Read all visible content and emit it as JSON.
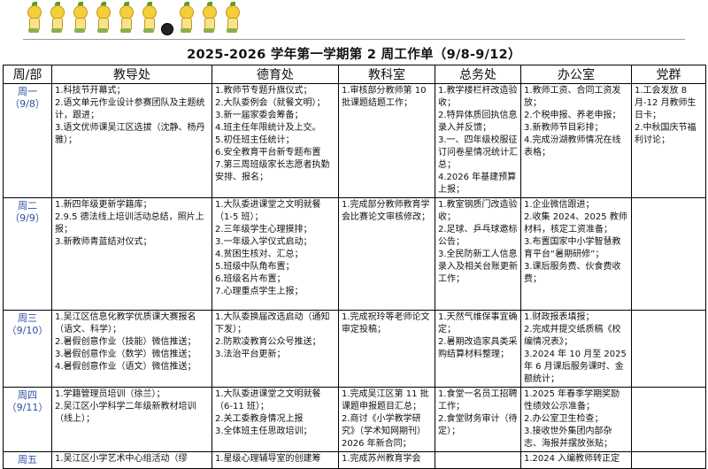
{
  "title": "2025-2026 学年第一学期第 2 周工作单（9/8-9/12）",
  "headers": [
    "周/部",
    "教导处",
    "德育处",
    "教科室",
    "总务处",
    "办公室",
    "党群"
  ],
  "rows": [
    {
      "day": "周一",
      "date": "（9/8）",
      "cells": [
        [
          "1.科技节开幕式；",
          "2.语文单元作业设计参赛团队及主题统计，跟进；",
          "3.语文优师课吴江区选拔（沈静、杨丹雅）；"
        ],
        [
          "1.教师节专题升旗仪式；",
          "2.大队委例会（就餐文明）；",
          "3.新一届家委会筹备；",
          "4.班主任年限统计及上交。",
          "5.初任班主任统计；",
          "6.安全教育平台新专题布置",
          "7.第三周班级家长志愿者执勤安排、报名；"
        ],
        [
          "1.审核部分教师第 10 批课题结题工作；"
        ],
        [
          "1.教学楼栏杆改造验收；",
          "2.特异体质回执信息录入并反馈；",
          "3.一、四年级校服征订问卷星情况统计汇总；",
          "4.2026 年基建预算上报；"
        ],
        [
          "1.教师工资、合同工资发放；",
          "2.个税申报、养老申报；",
          "3.新教师节目彩排；",
          "4.完成汾湖教师情况在线表格；"
        ],
        [
          "1.工会发放 8 月-12 月教师生日卡；",
          "2.中秋国庆节福利讨论；"
        ]
      ]
    },
    {
      "day": "周二",
      "date": "（9/9）",
      "cells": [
        [
          "1.新四年级更新学籍库；",
          "2.9.5 德法线上培训活动总结，照片上报；",
          "3.新教师青蓝结对仪式；"
        ],
        [
          "1.大队委进课堂之文明就餐（1-5 班）；",
          "2.三年级学生心理摸排；",
          "3.一年级入学仪式启动；",
          "4.贫困生核对、汇总；",
          "5.班级中队角布置；",
          "6.班级名片布置；",
          "7.心理重点学生上报；"
        ],
        [
          "1.完成部分教师教育学会比赛论文审核修改；"
        ],
        [
          "1.教室钢质门改造验收；",
          "2.足球、乒乓球邀标公告；",
          "3.全民防新工人信息录入及相关台账更新工作；"
        ],
        [
          "1.企业微信跟进；",
          "2.收集 2024、2025 教师材料，核定工资准备；",
          "3.布置国家中小学智慧教育平台“暑期研修”；",
          "3.课后服务费、伙食费收费；"
        ],
        []
      ]
    },
    {
      "day": "周三",
      "date": "（9/10）",
      "cells": [
        [
          "1.吴江区信息化教学优质课大赛报名（语文、科学）；",
          "2.暑假创意作业（技能）微信推送；",
          "3.暑假创意作业（数学）微信推送；",
          "4.暑假创意作业（语文）微信推送；"
        ],
        [
          "1.大队委换届改选启动（通知下发）；",
          "2.防欺凌教育公众号推送；",
          "3.法治平台更新；"
        ],
        [
          "1.完成祝玲等老师论文审定投稿；"
        ],
        [
          "1.天然气维保事宜确定；",
          "2.暑期改造家具类采购结算材料整理；"
        ],
        [
          "1.财政报表填报；",
          "2.完成并提交纸质稿《校编情况表》；",
          "3.2024 年 10 月至 2025 年 6 月课后服务课时、金额统计；"
        ],
        []
      ]
    },
    {
      "day": "周四",
      "date": "（9/11）",
      "cells": [
        [
          "1.学籍管理员培训（徐兰）；",
          "2.吴江区小学科学二年级新教材培训（线上）；"
        ],
        [
          "1.大队委进课堂之文明就餐（6-11 班）；",
          "2.关工委教身情况上报",
          "3.全体班主任思政培训；"
        ],
        [
          "1.完成吴江区第 11 批课题申报题目汇总；",
          "2.商讨《小学教学研究》（学术知网期刊）2026 年新合同；"
        ],
        [
          "1.食堂一名员工招聘工作；",
          "2.食堂财务审计（待定）；"
        ],
        [
          "1.2025 年春季学期奖励性绩效公示准备；",
          "2.办公室卫生检查；",
          "3.接收世外集团内部杂志、海报并摆放张贴；"
        ],
        []
      ]
    },
    {
      "day": "周五",
      "date": "",
      "cells": [
        [
          "1.吴江区小学艺术中心组活动（缪"
        ],
        [
          "1.星级心理辅导室的创建筹"
        ],
        [
          "1.完成苏州教育学会"
        ],
        [],
        [
          "1.2024 入编教师转正定"
        ],
        []
      ]
    }
  ]
}
